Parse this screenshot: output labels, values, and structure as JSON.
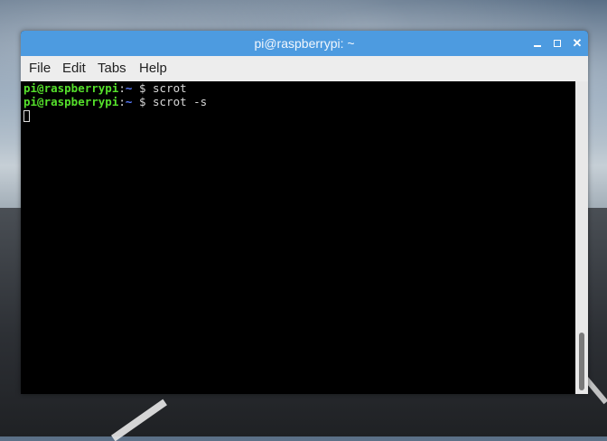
{
  "window": {
    "title": "pi@raspberrypi: ~",
    "controls": {
      "minimize_icon": "minimize-icon",
      "maximize_icon": "maximize-icon",
      "close_icon": "close-icon",
      "close_glyph": "✕"
    }
  },
  "menubar": {
    "items": [
      {
        "label": "File"
      },
      {
        "label": "Edit"
      },
      {
        "label": "Tabs"
      },
      {
        "label": "Help"
      }
    ]
  },
  "terminal": {
    "lines": [
      {
        "user": "pi@raspberrypi",
        "sep": ":",
        "path": "~",
        "prompt": " $ ",
        "command": "scrot"
      },
      {
        "user": "pi@raspberrypi",
        "sep": ":",
        "path": "~",
        "prompt": " $ ",
        "command": "scrot -s"
      }
    ]
  },
  "colors": {
    "titlebar": "#4d9be0",
    "user_prompt": "#55e02b",
    "path_prompt": "#5a7cff"
  }
}
